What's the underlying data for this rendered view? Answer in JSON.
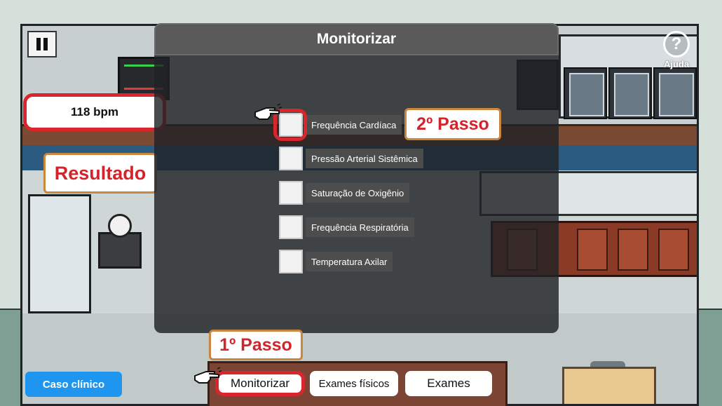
{
  "hud": {
    "pause_icon": "pause-icon",
    "help_icon": "question-icon",
    "help_label": "Ajuda",
    "heart_rate": "118 bpm"
  },
  "annotations": {
    "result": "Resultado",
    "step1": "1º Passo",
    "step2": "2º Passo",
    "highlight_color": "#d9252b"
  },
  "modal": {
    "title": "Monitorizar",
    "options": [
      {
        "label": "Frequência Cardíaca",
        "checked": false
      },
      {
        "label": "Pressão Arterial Sistêmica",
        "checked": false
      },
      {
        "label": "Saturação de Oxigênio",
        "checked": false
      },
      {
        "label": "Frequência Respiratória",
        "checked": false
      },
      {
        "label": "Temperatura Axilar",
        "checked": false
      }
    ]
  },
  "bottom": {
    "case_button": "Caso clínico",
    "case_button_color": "#1e96f0",
    "actions": {
      "monitor": "Monitorizar",
      "physical": "Exames físicos",
      "exams": "Exames"
    }
  }
}
